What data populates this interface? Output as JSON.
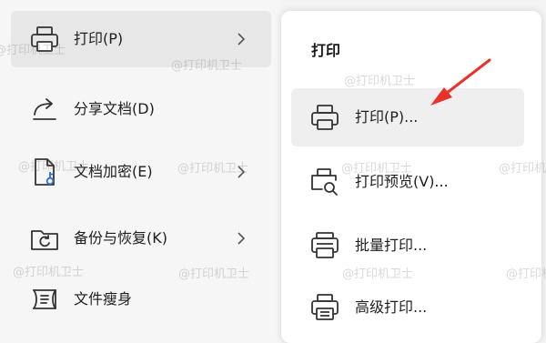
{
  "left_menu": {
    "items": [
      {
        "label": "打印(P)",
        "icon": "printer-icon",
        "has_submenu": true,
        "active": true
      },
      {
        "label": "分享文档(D)",
        "icon": "share-icon",
        "has_submenu": false
      },
      {
        "label": "文档加密(E)",
        "icon": "document-lock-icon",
        "has_submenu": true
      },
      {
        "label": "备份与恢复(K)",
        "icon": "backup-restore-icon",
        "has_submenu": true
      },
      {
        "label": "文件瘦身",
        "icon": "file-slim-icon",
        "has_submenu": false
      }
    ]
  },
  "submenu": {
    "title": "打印",
    "items": [
      {
        "label": "打印(P)...",
        "icon": "printer-icon",
        "highlighted": true
      },
      {
        "label": "打印预览(V)...",
        "icon": "print-preview-icon"
      },
      {
        "label": "批量打印...",
        "icon": "batch-print-icon"
      },
      {
        "label": "高级打印...",
        "icon": "advanced-print-icon"
      }
    ]
  },
  "watermark": {
    "text": "@打印机卫士"
  },
  "annotation": {
    "arrow_color": "#e8332a"
  }
}
